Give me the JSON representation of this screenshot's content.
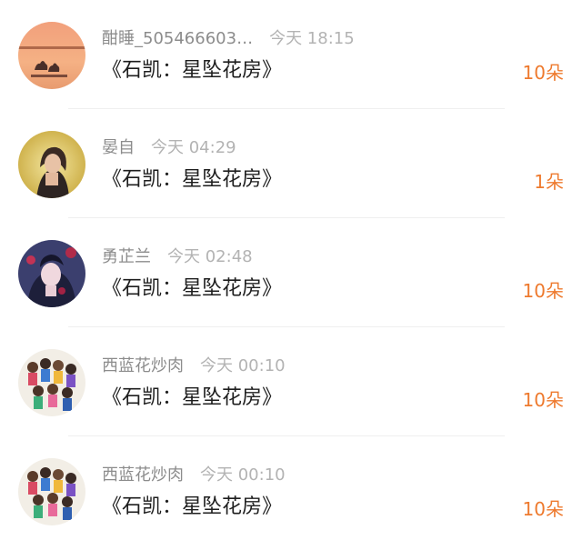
{
  "gifts": [
    {
      "avatar_icon": "sunset-cats-avatar-icon",
      "username": "酣睡_505466603…",
      "time": "今天 18:15",
      "title": "《石凯：星坠花房》",
      "amount": "10朵"
    },
    {
      "avatar_icon": "woman-portrait-avatar-icon",
      "username": "晏自",
      "time": "今天 04:29",
      "title": "《石凯：星坠花房》",
      "amount": "1朵"
    },
    {
      "avatar_icon": "illustrated-woman-avatar-icon",
      "username": "勇芷兰",
      "time": "今天 02:48",
      "title": "《石凯：星坠花房》",
      "amount": "10朵"
    },
    {
      "avatar_icon": "cartoon-group-avatar-icon",
      "username": "西蓝花炒肉",
      "time": "今天 00:10",
      "title": "《石凯：星坠花房》",
      "amount": "10朵"
    },
    {
      "avatar_icon": "cartoon-group-avatar-icon",
      "username": "西蓝花炒肉",
      "time": "今天 00:10",
      "title": "《石凯：星坠花房》",
      "amount": "10朵"
    }
  ],
  "colors": {
    "amount": "#ee7a2e",
    "username": "#8c8c8c",
    "time": "#b3b3b3",
    "title": "#1e1e1e",
    "divider": "#efefef"
  }
}
